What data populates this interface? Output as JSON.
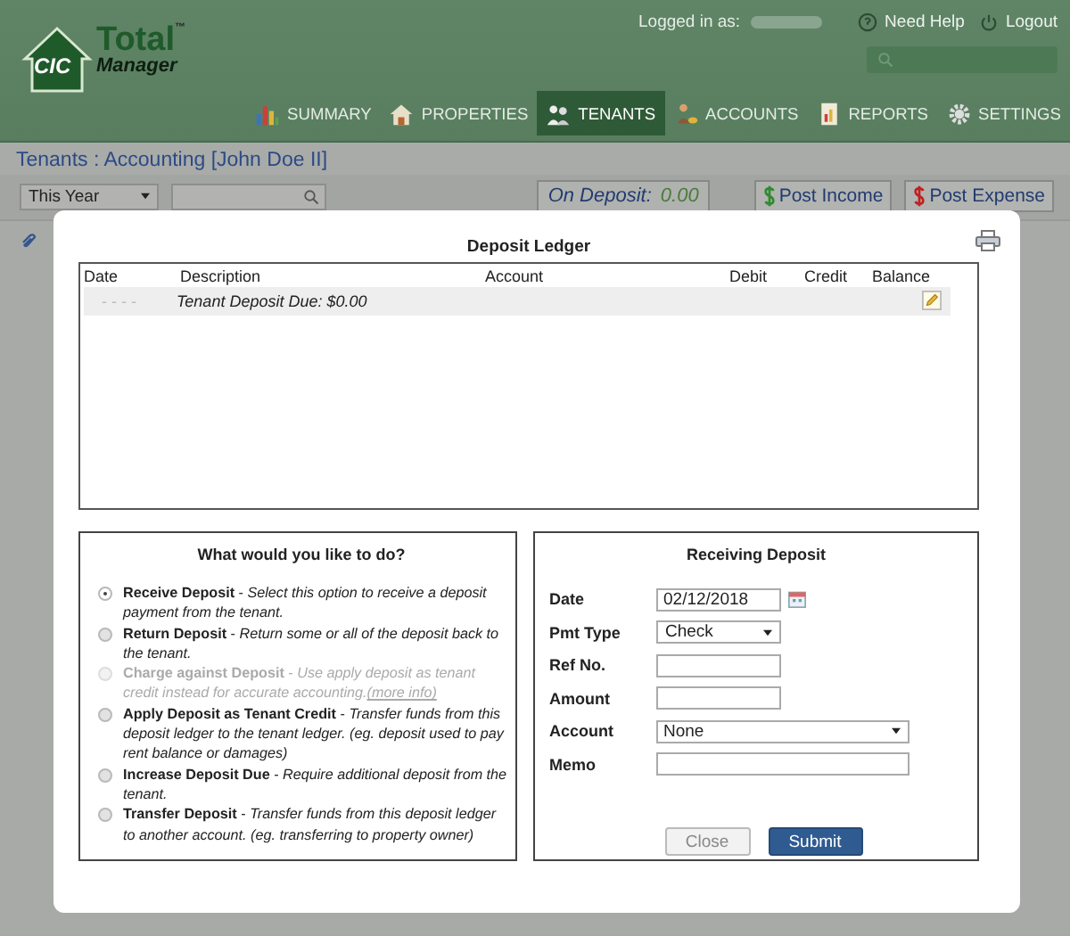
{
  "header": {
    "logo": {
      "mark": "CIC",
      "word_1": "Total",
      "word_2": "Manager",
      "trademark": "™"
    },
    "logged_in_label": "Logged in as:",
    "links": [
      {
        "kind": "help",
        "label": "Need Help"
      },
      {
        "kind": "logout",
        "label": "Logout"
      }
    ],
    "nav": [
      {
        "kind": "summary",
        "label": "SUMMARY",
        "selected": false
      },
      {
        "kind": "properties",
        "label": "PROPERTIES",
        "selected": false
      },
      {
        "kind": "tenants",
        "label": "TENANTS",
        "selected": true
      },
      {
        "kind": "accounts",
        "label": "ACCOUNTS",
        "selected": false
      },
      {
        "kind": "reports",
        "label": "REPORTS",
        "selected": false
      },
      {
        "kind": "settings",
        "label": "SETTINGS",
        "selected": false
      }
    ]
  },
  "breadcrumb": "Tenants : Accounting [John Doe II]",
  "toolbar": {
    "period": "This Year",
    "on_deposit_label": "On Deposit:",
    "on_deposit_value": "0.00",
    "buttons": [
      {
        "kind": "income",
        "label": "Post Income"
      },
      {
        "kind": "expense",
        "label": "Post Expense"
      }
    ]
  },
  "modal": {
    "title": "Deposit Ledger",
    "ledger": {
      "columns": [
        "Date",
        "Description",
        "Account",
        "Debit",
        "Credit",
        "Balance"
      ],
      "rows": [
        {
          "date": "- - - -",
          "description": "Tenant Deposit Due: $0.00"
        }
      ]
    },
    "options": {
      "title": "What would you like to do?",
      "items": [
        {
          "text": "**Receive Deposit** - *Select this option to receive a deposit payment from the tenant.*",
          "selected": true,
          "disabled": false
        },
        {
          "text": "**Return Deposit** - *Return some or all of the deposit back to the tenant.*",
          "selected": false,
          "disabled": false
        },
        {
          "text": "**Charge against Deposit** - *Use apply deposit as tenant credit instead for accurate accounting.*",
          "link": "(more info)",
          "selected": false,
          "disabled": true
        },
        {
          "text": "**Apply Deposit as Tenant Credit** - *Transfer funds from this deposit ledger to the tenant ledger. (eg. deposit used to pay rent balance or damages)*",
          "selected": false,
          "disabled": false
        },
        {
          "text": "**Increase Deposit Due** - *Require additional deposit from the tenant.*",
          "selected": false,
          "disabled": false
        },
        {
          "text": "**Transfer Deposit** - *Transfer funds from this deposit ledger to another account. (eg. transferring to property owner)*",
          "selected": false,
          "disabled": false
        }
      ]
    },
    "form": {
      "title": "Receiving Deposit",
      "fields": [
        {
          "kind": "date",
          "label": "Date",
          "value": "02/12/2018"
        },
        {
          "kind": "select",
          "label": "Pmt Type",
          "value": "Check"
        },
        {
          "kind": "text",
          "label": "Ref No."
        },
        {
          "kind": "text",
          "label": "Amount"
        },
        {
          "kind": "select",
          "label": "Account",
          "value": "None"
        },
        {
          "kind": "text",
          "label": "Memo"
        }
      ],
      "buttons": [
        {
          "kind": "secondary",
          "label": "Close"
        },
        {
          "kind": "primary",
          "label": "Submit"
        }
      ]
    }
  }
}
